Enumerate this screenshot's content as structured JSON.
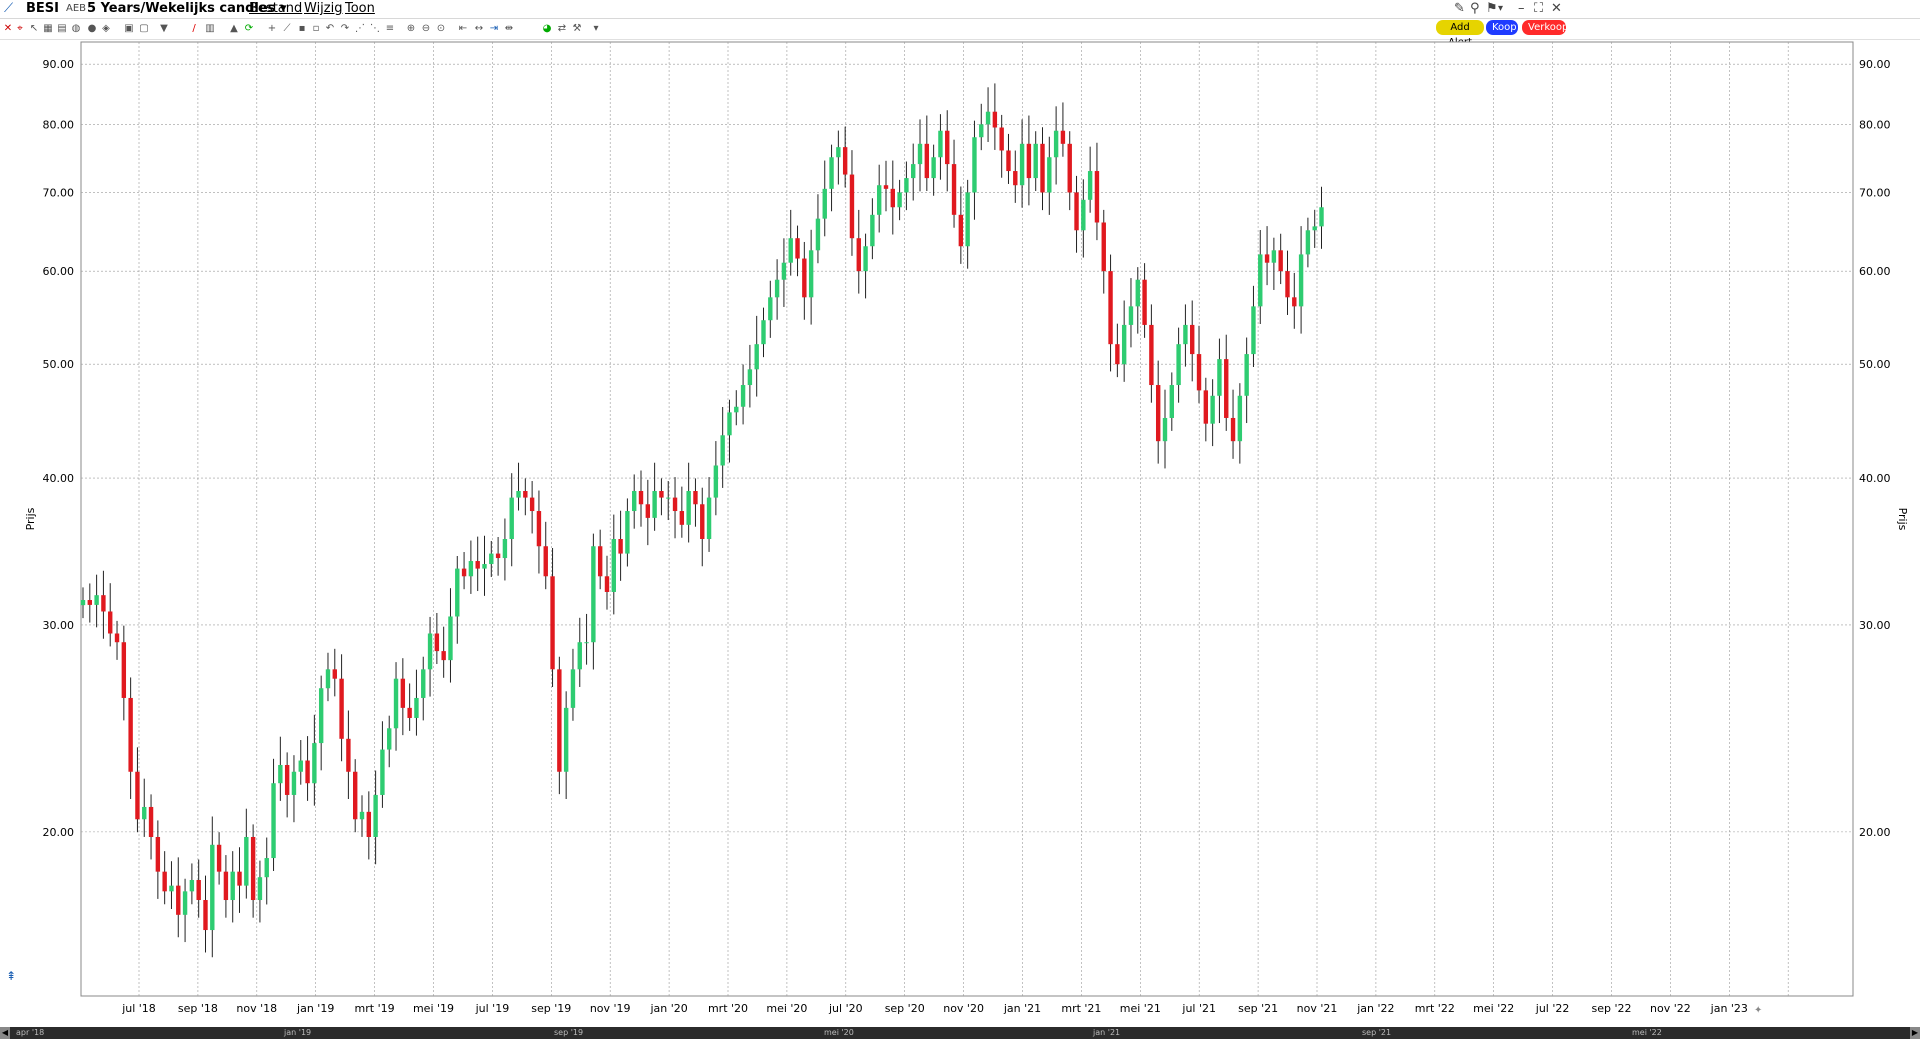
{
  "menubar": {
    "symbol": "BESI",
    "exchange": "AEB",
    "period": "5 Years/Wekelijks candles",
    "menu": [
      "Bestand",
      "Wijzig",
      "Toon"
    ]
  },
  "buttons": {
    "add_alert": "Add Alert",
    "buy": "Koop",
    "sell": "Verkoop"
  },
  "colors": {
    "up": "#2ecc71",
    "down": "#e0191f",
    "grid": "#9a9a9a",
    "buy": "#1f3bff",
    "sell": "#ff2a2a",
    "alert": "#d8c800"
  },
  "chart_data": {
    "type": "candlestick",
    "scale": "log",
    "ylabel": "Prijs",
    "ylim": [
      14.5,
      94
    ],
    "y_ticks": [
      "90.00",
      "80.00",
      "70.00",
      "60.00",
      "50.00",
      "40.00",
      "30.00",
      "20.00"
    ],
    "x_ticks": [
      "jul '18",
      "sep '18",
      "nov '18",
      "jan '19",
      "mrt '19",
      "mei '19",
      "jul '19",
      "sep '19",
      "nov '19",
      "jan '20",
      "mrt '20",
      "mei '20",
      "jul '20",
      "sep '20",
      "nov '20",
      "jan '21",
      "mrt '21",
      "mei '21",
      "jul '21",
      "sep '21",
      "nov '21",
      "jan '22",
      "mrt '22",
      "mei '22",
      "jul '22",
      "sep '22",
      "nov '22",
      "jan '23"
    ],
    "closes": [
      31.5,
      31.2,
      31.8,
      30.8,
      29.5,
      29.0,
      26.0,
      22.5,
      20.5,
      21.0,
      19.8,
      18.5,
      17.8,
      18.0,
      17.0,
      17.8,
      18.2,
      17.5,
      16.5,
      19.5,
      18.5,
      17.5,
      18.5,
      18.0,
      19.8,
      17.5,
      18.3,
      19.0,
      22.0,
      22.8,
      21.5,
      22.5,
      23.0,
      22.0,
      23.8,
      26.5,
      27.5,
      27.0,
      24.0,
      22.5,
      20.5,
      20.8,
      19.8,
      21.5,
      23.5,
      24.5,
      27.0,
      25.5,
      25.0,
      26.0,
      27.5,
      29.5,
      28.5,
      28.0,
      30.5,
      33.5,
      33.0,
      34.0,
      33.5,
      33.8,
      34.5,
      34.2,
      35.5,
      38.5,
      39.0,
      38.5,
      37.5,
      35.0,
      33.0,
      27.5,
      22.5,
      25.5,
      27.5,
      29.0,
      29.0,
      35.0,
      33.0,
      32.0,
      35.5,
      34.5,
      37.5,
      39.0,
      38.0,
      37.0,
      39.0,
      38.5,
      38.5,
      37.5,
      36.5,
      39.0,
      38.0,
      35.5,
      38.5,
      41.0,
      43.5,
      45.5,
      46.0,
      48.0,
      49.5,
      52.0,
      54.5,
      57.0,
      59.0,
      61.0,
      64.0,
      61.5,
      57.0,
      62.5,
      66.5,
      70.5,
      75.0,
      76.5,
      72.5,
      64.0,
      60.0,
      63.0,
      67.0,
      71.0,
      70.5,
      68.0,
      70.0,
      72.0,
      74.0,
      77.0,
      72.0,
      75.0,
      79.0,
      74.0,
      67.0,
      63.0,
      70.0,
      78.0,
      80.0,
      82.0,
      79.5,
      76.0,
      73.0,
      71.0,
      77.0,
      72.0,
      77.0,
      70.0,
      75.0,
      79.0,
      77.0,
      70.0,
      65.0,
      69.0,
      73.0,
      66.0,
      60.0,
      52.0,
      50.0,
      54.0,
      56.0,
      59.0,
      54.0,
      48.0,
      43.0,
      45.0,
      48.0,
      52.0,
      54.0,
      51.0,
      47.5,
      44.5,
      47.0,
      50.5,
      45.0,
      43.0,
      47.0,
      51.0,
      56.0,
      62.0,
      61.0,
      62.5,
      60.0,
      57.0,
      56.0,
      62.0,
      65.0,
      65.5,
      68.0
    ]
  },
  "statusbar": {
    "labels": [
      "apr '18",
      "jan '19",
      "sep '19",
      "mei '20",
      "jan '21",
      "sep '21",
      "mei '22"
    ]
  }
}
